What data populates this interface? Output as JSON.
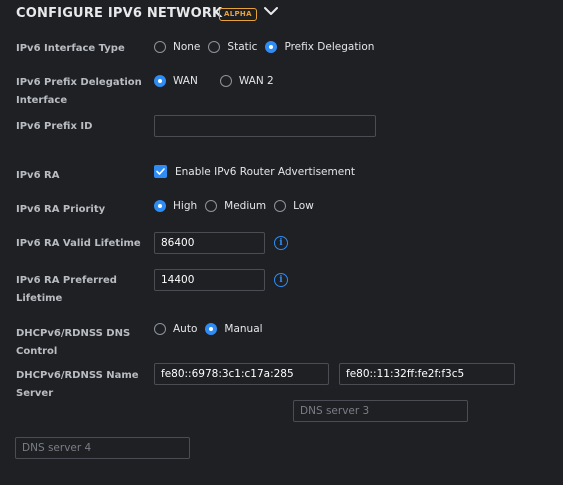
{
  "header": {
    "title": "CONFIGURE IPV6 NETWORK",
    "badge": "ALPHA",
    "chevron_icon": "chevron-down-icon"
  },
  "colors": {
    "accent": "#2f8cf4",
    "badge": "#e8a23a",
    "background": "#1e2024"
  },
  "fields": {
    "interface_type": {
      "label": "IPv6 Interface Type",
      "options": [
        "None",
        "Static",
        "Prefix Delegation"
      ],
      "selected": "Prefix Delegation"
    },
    "prefix_delegation_interface": {
      "label_line1": "IPv6 Prefix Delegation",
      "label_line2": "Interface",
      "options": [
        "WAN",
        "WAN 2"
      ],
      "selected": "WAN"
    },
    "prefix_id": {
      "label": "IPv6 Prefix ID",
      "value": ""
    },
    "ra": {
      "label": "IPv6 RA",
      "checkbox_label": "Enable IPv6 Router Advertisement",
      "checked": true
    },
    "ra_priority": {
      "label": "IPv6 RA Priority",
      "options": [
        "High",
        "Medium",
        "Low"
      ],
      "selected": "High"
    },
    "ra_valid_lifetime": {
      "label": "IPv6 RA Valid Lifetime",
      "value": "86400",
      "info_icon": "info-icon"
    },
    "ra_preferred_lifetime": {
      "label_line1": "IPv6 RA Preferred",
      "label_line2": "Lifetime",
      "value": "14400",
      "info_icon": "info-icon"
    },
    "dns_control": {
      "label_line1": "DHCPv6/RDNSS DNS",
      "label_line2": "Control",
      "options": [
        "Auto",
        "Manual"
      ],
      "selected": "Manual"
    },
    "dns_servers": {
      "label_line1": "DHCPv6/RDNSS Name",
      "label_line2": "Server",
      "server1": "fe80::6978:3c1:c17a:285",
      "server2": "fe80::11:32ff:fe2f:f3c5",
      "server3_placeholder": "DNS server 3",
      "server4_placeholder": "DNS server 4"
    }
  }
}
